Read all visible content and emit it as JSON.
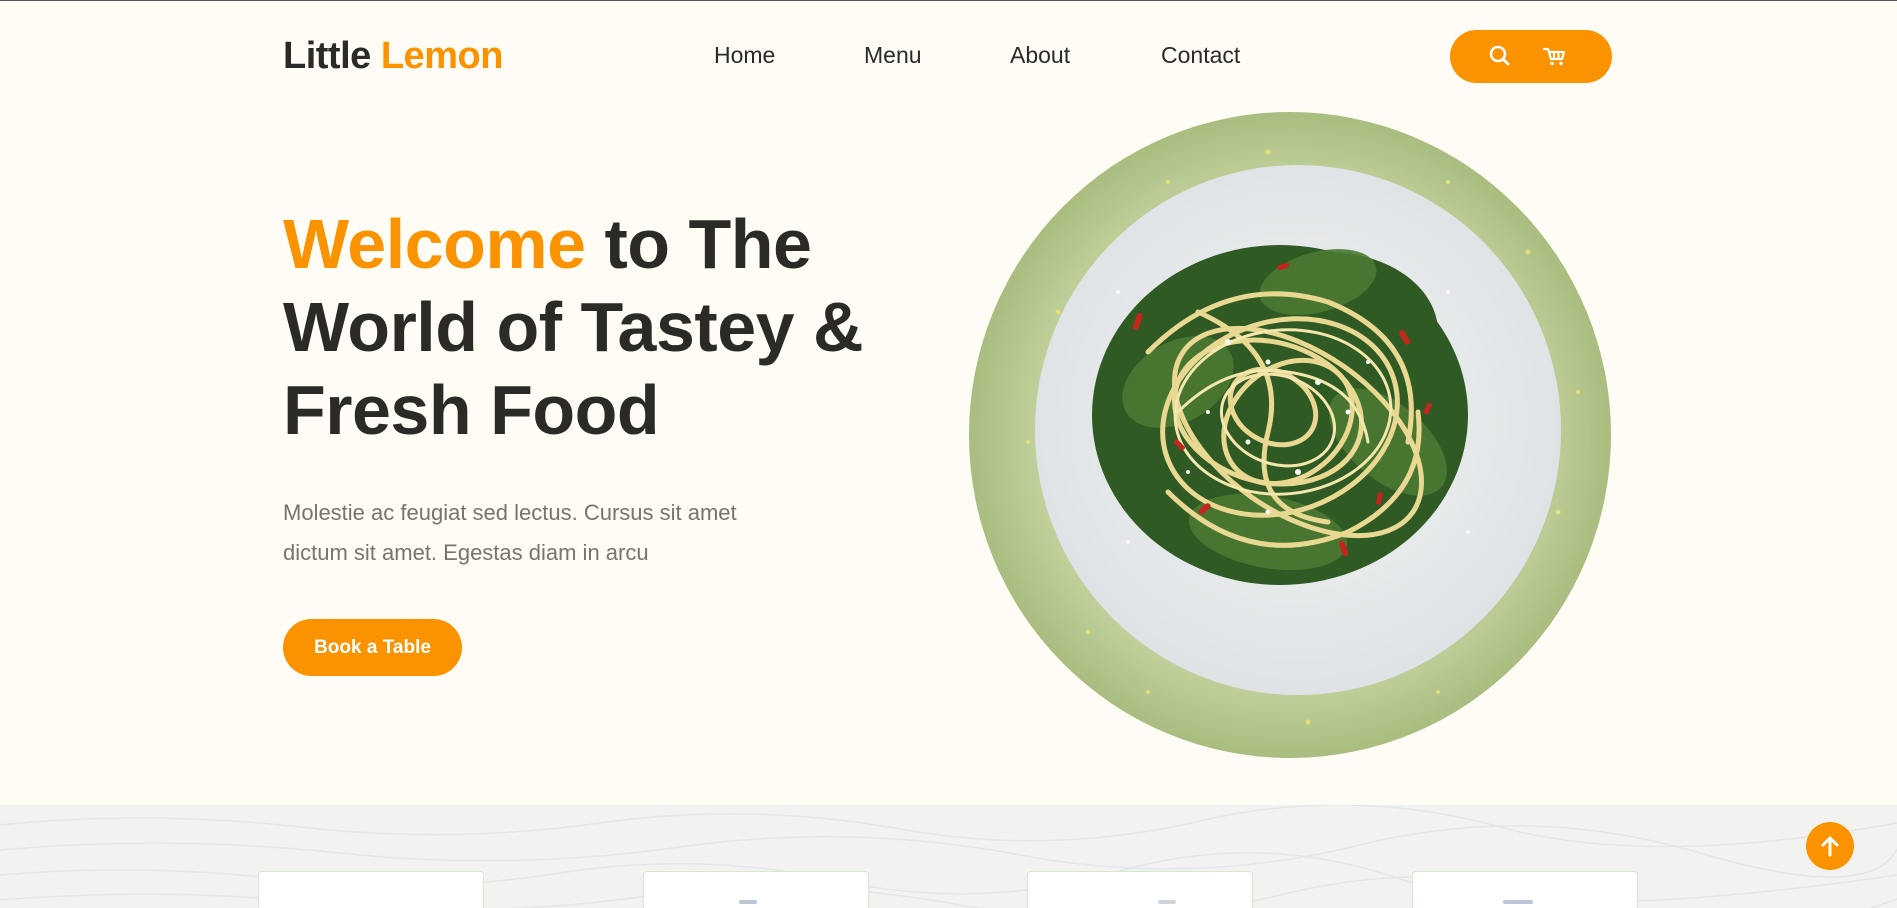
{
  "brand": {
    "name_part1": "Little",
    "name_part2": "Lemon",
    "accent_color": "#fb9300",
    "text_color": "#2b2a26",
    "background_color": "#fffcf5"
  },
  "nav": {
    "items": [
      {
        "label": "Home"
      },
      {
        "label": "Menu"
      },
      {
        "label": "About"
      },
      {
        "label": "Contact"
      }
    ]
  },
  "header_actions": {
    "icons": [
      "search-icon",
      "cart-icon"
    ]
  },
  "hero": {
    "title_accent": "Welcome",
    "title_rest": " to The World of Tastey & Fresh Food",
    "description": "Molestie ac feugiat sed lectus. Cursus sit amet dictum sit amet. Egestas diam in arcu",
    "cta_label": "Book a Table",
    "image": "pasta-dish-plate"
  },
  "features": {
    "card_count_visible": 4
  },
  "scroll_top": {
    "icon": "arrow-up-icon"
  }
}
